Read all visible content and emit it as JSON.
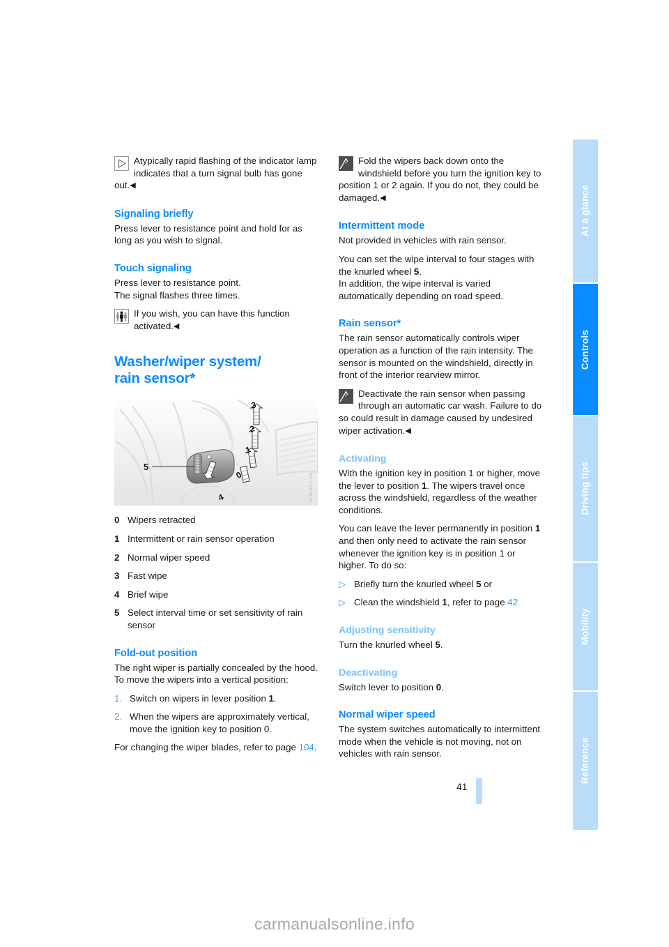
{
  "page": {
    "number": "41",
    "watermark": "carmanualsonline.info"
  },
  "tabs": [
    {
      "label": "At a glance",
      "active": false
    },
    {
      "label": "Controls",
      "active": true
    },
    {
      "label": "Driving tips",
      "active": false
    },
    {
      "label": "Mobility",
      "active": false
    },
    {
      "label": "Reference",
      "active": false
    }
  ],
  "left_column": {
    "note_indicator": {
      "icon": "hint-triangle-icon",
      "text_part1": "Atypically rapid flashing of the indicator lamp indicates that a turn signal bulb has gone out.",
      "endmark": "◀"
    },
    "signaling_briefly": {
      "heading": "Signaling briefly",
      "body": "Press lever to resistance point and hold for as long as you wish to signal."
    },
    "touch_signaling": {
      "heading": "Touch signaling",
      "body1": "Press lever to resistance point.",
      "body2": "The signal flashes three times.",
      "note": {
        "icon": "service-people-icon",
        "text": "If you wish, you can have this function activated.",
        "endmark": "◀"
      }
    },
    "washer_wiper": {
      "title_line1": "Washer/wiper system/",
      "title_line2": "rain sensor*",
      "figure": {
        "callout_labels": [
          "0",
          "1",
          "2",
          "3",
          "4",
          "5"
        ],
        "code": "WL-C-05-41-01"
      },
      "legend": [
        {
          "num": "0",
          "text": "Wipers retracted"
        },
        {
          "num": "1",
          "text": "Intermittent or rain sensor operation"
        },
        {
          "num": "2",
          "text": "Normal wiper speed"
        },
        {
          "num": "3",
          "text": "Fast wipe"
        },
        {
          "num": "4",
          "text": "Brief wipe"
        },
        {
          "num": "5",
          "text": "Select interval time or set sensitivity of rain sensor"
        }
      ]
    },
    "fold_out": {
      "heading": "Fold-out position",
      "body1": "The right wiper is partially concealed by the hood.",
      "body2": "To move the wipers into a vertical position:",
      "steps": [
        {
          "num": "1.",
          "pre": "Switch on wipers in lever position ",
          "bold": "1",
          "post": "."
        },
        {
          "num": "2.",
          "pre": "When the wipers are approximately vertical, move the ignition key to position 0.",
          "bold": "",
          "post": ""
        }
      ],
      "closing_pre": "For changing the wiper blades, refer to page ",
      "closing_link": "104",
      "closing_post": "."
    }
  },
  "right_column": {
    "note_fold": {
      "icon": "warning-triangle-icon",
      "text": "Fold the wipers back down onto the windshield before you turn the ignition key to position 1 or 2 again. If you do not, they could be damaged.",
      "endmark": "◀"
    },
    "intermittent": {
      "heading": "Intermittent mode",
      "body1": "Not provided in vehicles with rain sensor.",
      "body2_pre": "You can set the wipe interval to four stages with the knurled wheel ",
      "body2_bold": "5",
      "body2_post": ".",
      "body3": "In addition, the wipe interval is varied automatically depending on road speed."
    },
    "rain_sensor": {
      "heading": "Rain sensor*",
      "body": "The rain sensor automatically controls wiper operation as a function of the rain intensity. The sensor is mounted on the windshield, directly in front of the interior rearview mirror.",
      "note": {
        "icon": "warning-triangle-icon",
        "text": "Deactivate the rain sensor when passing through an automatic car wash. Failure to do so could result in damage caused by undesired wiper activation.",
        "endmark": "◀"
      }
    },
    "activating": {
      "heading": "Activating",
      "body1_pre": "With the ignition key in position 1 or higher, move the lever to position ",
      "body1_bold": "1",
      "body1_post": ". The wipers travel once across the windshield, regardless of the weather conditions.",
      "body2_pre": "You can leave the lever permanently in position ",
      "body2_bold": "1",
      "body2_post": " and then only need to activate the rain sensor whenever the ignition key is in position 1 or higher. To do so:",
      "bullets": [
        {
          "marker": "▷",
          "pre": "Briefly turn the knurled wheel ",
          "bold": "5",
          "post": " or",
          "link": ""
        },
        {
          "marker": "▷",
          "pre": "Clean the windshield ",
          "bold": "1",
          "post": ", refer to page ",
          "link": "42"
        }
      ]
    },
    "adjusting": {
      "heading": "Adjusting sensitivity",
      "body_pre": "Turn the knurled wheel ",
      "body_bold": "5",
      "body_post": "."
    },
    "deactivating": {
      "heading": "Deactivating",
      "body_pre": "Switch lever to position ",
      "body_bold": "0",
      "body_post": "."
    },
    "normal_speed": {
      "heading": "Normal wiper speed",
      "body": "The system switches automatically to intermittent mode when the vehicle is not moving, not on vehicles with rain sensor."
    }
  },
  "colors": {
    "accent_blue": "#0a8cff",
    "light_blue": "#7cc2f7",
    "tab_inactive": "#b9dcfb",
    "link_blue": "#2f9bf3"
  }
}
